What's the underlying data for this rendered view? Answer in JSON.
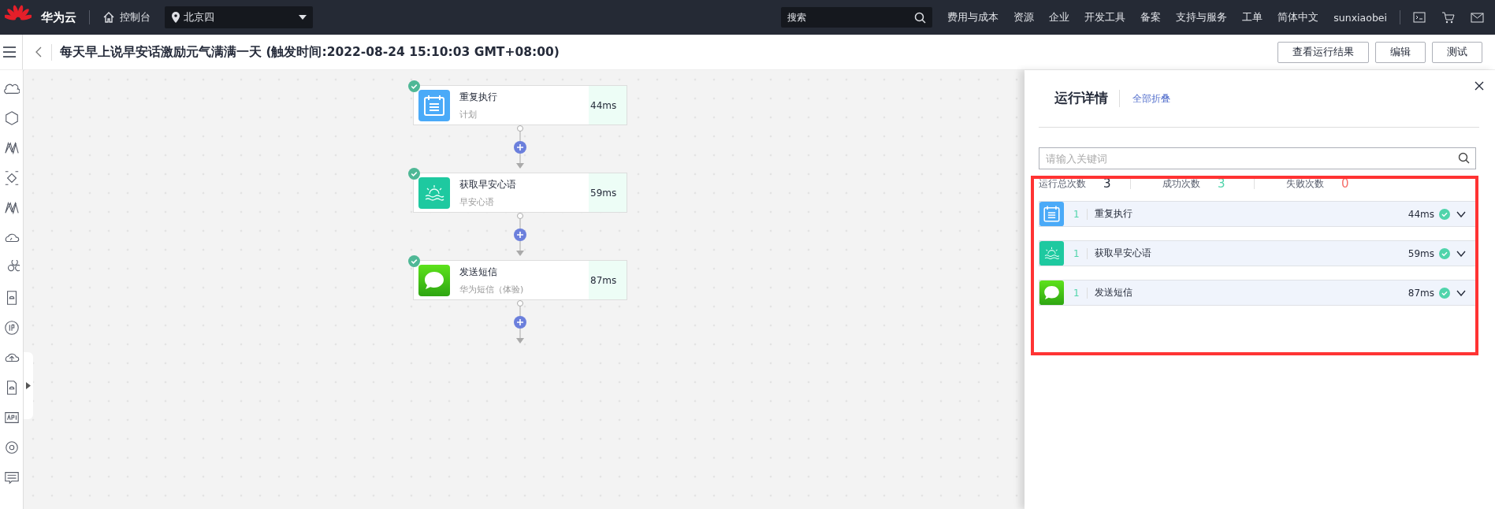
{
  "top_bar": {
    "brand": "华为云",
    "console": "控制台",
    "region": "北京四",
    "search": {
      "placeholder": "搜索"
    },
    "nav": [
      "费用与成本",
      "资源",
      "企业",
      "开发工具",
      "备案",
      "支持与服务",
      "工单",
      "简体中文"
    ],
    "user": "sunxiaobei"
  },
  "header": {
    "title": "每天早上说早安话激励元气满满一天 (触发时间:2022-08-24 15:10:03 GMT+08:00)",
    "buttons": [
      "查看运行结果",
      "编辑",
      "测试"
    ]
  },
  "flow": [
    {
      "title": "重复执行",
      "subtitle": "计划",
      "duration": "44ms",
      "kind": "schedule",
      "done": true
    },
    {
      "title": "获取早安心语",
      "subtitle": "早安心语",
      "duration": "59ms",
      "kind": "sunrise",
      "done": true
    },
    {
      "title": "发送短信",
      "subtitle": "华为短信（体验)",
      "duration": "87ms",
      "kind": "message",
      "done": true
    }
  ],
  "panel": {
    "title": "运行详情",
    "collapse_all": "全部折叠",
    "search": {
      "placeholder": "请输入关键词"
    },
    "stats": [
      {
        "label": "运行总次数",
        "value": "3",
        "color": "#252b3a"
      },
      {
        "label": "成功次数",
        "value": "3",
        "color": "#50d4ab"
      },
      {
        "label": "失败次数",
        "value": "0",
        "color": "#f66f6a"
      }
    ],
    "rows": [
      {
        "index": "1",
        "name": "重复执行",
        "duration": "44ms",
        "kind": "schedule",
        "done": true,
        "expanded": false
      },
      {
        "index": "1",
        "name": "获取早安心语",
        "duration": "59ms",
        "kind": "sunrise",
        "done": true,
        "expanded": false
      },
      {
        "index": "1",
        "name": "发送短信",
        "duration": "87ms",
        "kind": "message",
        "done": true,
        "expanded": false
      }
    ]
  }
}
